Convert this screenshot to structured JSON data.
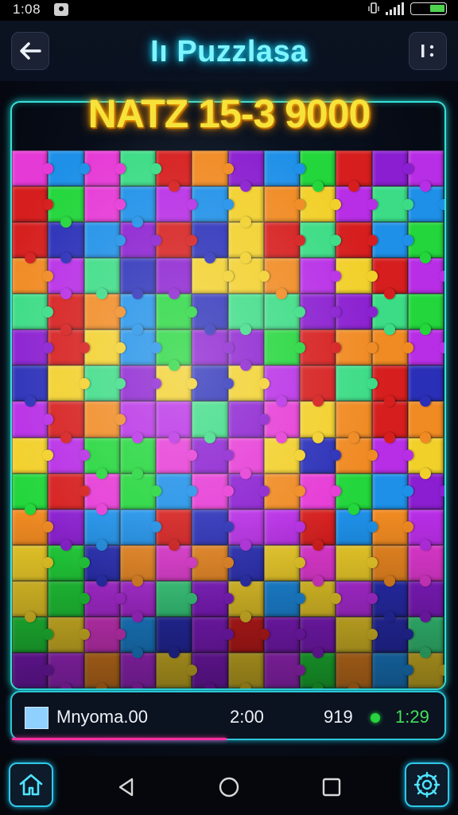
{
  "status_bar": {
    "time": "1:08"
  },
  "header": {
    "title": "Iı Puzzlasa",
    "back_label": "←",
    "menu_label": "⋮"
  },
  "board": {
    "headline": "NATZ 15-3 9000",
    "palette": [
      "#8a1ed0",
      "#22d63b",
      "#1e90e8",
      "#f2d02a",
      "#d61e1e",
      "#e63ad6",
      "#2a2fb8",
      "#f08a22",
      "#3bdc85",
      "#b82ee6"
    ]
  },
  "status_panel": {
    "name": "Mnyoma.00",
    "time": "2:00",
    "score": "919",
    "timer": "1:29"
  },
  "icons": {
    "back": "arrow-left-icon",
    "menu": "more-vert-icon",
    "home": "home-icon",
    "settings": "gear-icon",
    "nav_back": "triangle-back-icon",
    "nav_home": "circle-home-icon",
    "nav_recent": "square-recent-icon"
  }
}
